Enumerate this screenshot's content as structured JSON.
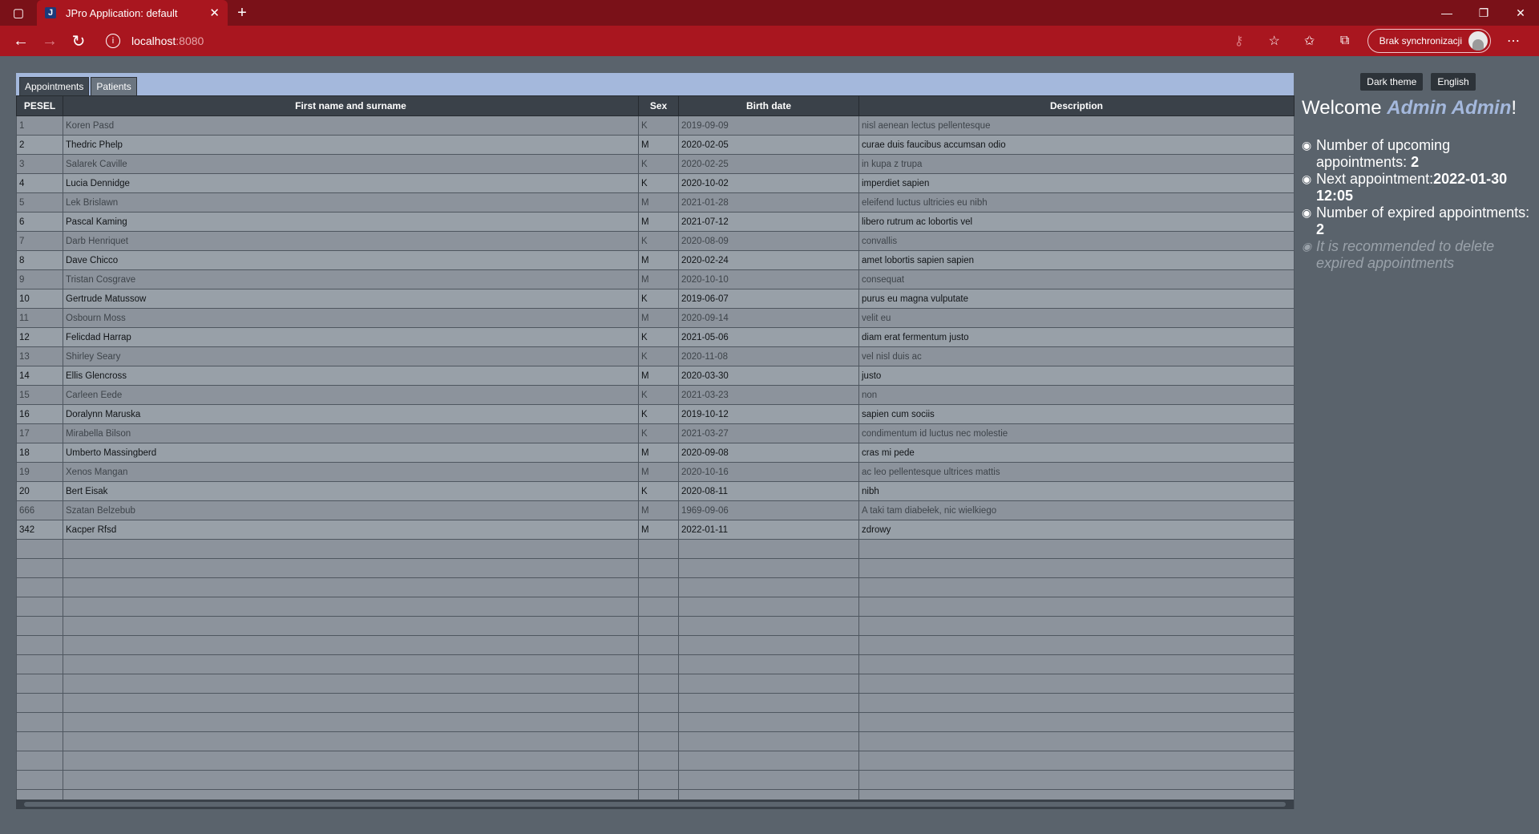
{
  "browser": {
    "tab_title": "JPro Application: default",
    "favicon_letter": "J",
    "url_host": "localhost",
    "url_port": ":8080",
    "sync_label": "Brak synchronizacji"
  },
  "app": {
    "tabs": [
      "Appointments",
      "Patients"
    ],
    "columns": [
      "PESEL",
      "First name and surname",
      "Sex",
      "Birth date",
      "Description"
    ],
    "rows": [
      [
        "1",
        "Koren Pasd",
        "K",
        "2019-09-09",
        "nisl aenean lectus pellentesque"
      ],
      [
        "2",
        "Thedric Phelp",
        "M",
        "2020-02-05",
        "curae duis faucibus accumsan odio"
      ],
      [
        "3",
        "Salarek Caville",
        "K",
        "2020-02-25",
        "in kupa z trupa"
      ],
      [
        "4",
        "Lucia Dennidge",
        "K",
        "2020-10-02",
        "imperdiet sapien"
      ],
      [
        "5",
        "Lek Brislawn",
        "M",
        "2021-01-28",
        "eleifend luctus ultricies eu nibh"
      ],
      [
        "6",
        "Pascal Kaming",
        "M",
        "2021-07-12",
        "libero rutrum ac lobortis vel"
      ],
      [
        "7",
        "Darb Henriquet",
        "K",
        "2020-08-09",
        "convallis"
      ],
      [
        "8",
        "Dave Chicco",
        "M",
        "2020-02-24",
        "amet lobortis sapien sapien"
      ],
      [
        "9",
        "Tristan Cosgrave",
        "M",
        "2020-10-10",
        "consequat"
      ],
      [
        "10",
        "Gertrude Matussow",
        "K",
        "2019-06-07",
        "purus eu magna vulputate"
      ],
      [
        "11",
        "Osbourn Moss",
        "M",
        "2020-09-14",
        "velit eu"
      ],
      [
        "12",
        "Felicdad Harrap",
        "K",
        "2021-05-06",
        "diam erat fermentum justo"
      ],
      [
        "13",
        "Shirley Seary",
        "K",
        "2020-11-08",
        "vel nisl duis ac"
      ],
      [
        "14",
        "Ellis Glencross",
        "M",
        "2020-03-30",
        "justo"
      ],
      [
        "15",
        "Carleen Eede",
        "K",
        "2021-03-23",
        "non"
      ],
      [
        "16",
        "Doralynn Maruska",
        "K",
        "2019-10-12",
        "sapien cum sociis"
      ],
      [
        "17",
        "Mirabella Bilson",
        "K",
        "2021-03-27",
        "condimentum id luctus nec molestie"
      ],
      [
        "18",
        "Umberto Massingberd",
        "M",
        "2020-09-08",
        "cras mi pede"
      ],
      [
        "19",
        "Xenos Mangan",
        "M",
        "2020-10-16",
        "ac leo pellentesque ultrices mattis"
      ],
      [
        "20",
        "Bert Eisak",
        "K",
        "2020-08-11",
        "nibh"
      ],
      [
        "666",
        "Szatan Belzebub",
        "M",
        "1969-09-06",
        "A taki tam diabełek, nic wielkiego"
      ],
      [
        "342",
        "Kacper Rfsd",
        "M",
        "2022-01-11",
        "zdrowy"
      ]
    ],
    "empty_rows": 14,
    "side": {
      "theme_button": "Dark theme",
      "language_button": "English",
      "welcome_prefix": "Welcome ",
      "user_name": "Admin Admin",
      "welcome_suffix": "!",
      "upcoming_label": "Number of upcoming appointments: ",
      "upcoming_value": "2",
      "next_label": "Next appointment:",
      "next_value": "2022-01-30 12:05",
      "expired_label": "Number of expired appointments: ",
      "expired_value": "2",
      "recommendation": "It is recommended to delete expired appointments"
    }
  }
}
